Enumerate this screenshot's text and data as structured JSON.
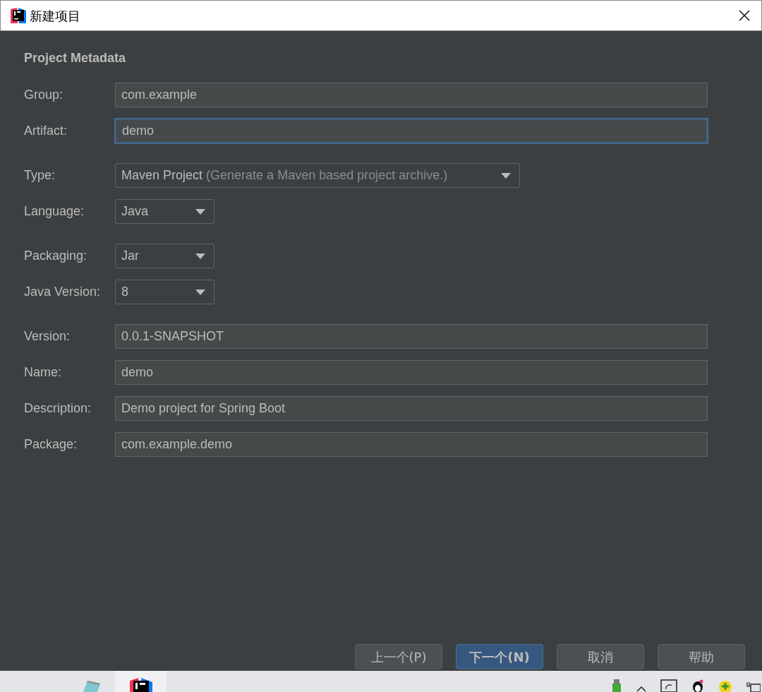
{
  "window": {
    "title": "新建项目"
  },
  "heading": "Project Metadata",
  "sections": [
    [
      {
        "label": "Group:",
        "kind": "text",
        "value": "com.example",
        "focused": false
      },
      {
        "label": "Artifact:",
        "kind": "text",
        "value": "demo",
        "focused": true
      }
    ],
    [
      {
        "label": "Type:",
        "kind": "select",
        "value": "Maven Project",
        "hint": "(Generate a Maven based project archive.)"
      },
      {
        "label": "Language:",
        "kind": "select",
        "value": "Java"
      }
    ],
    [
      {
        "label": "Packaging:",
        "kind": "select",
        "value": "Jar"
      },
      {
        "label": "Java Version:",
        "kind": "select",
        "value": "8"
      }
    ],
    [
      {
        "label": "Version:",
        "kind": "text",
        "value": "0.0.1-SNAPSHOT",
        "focused": false
      },
      {
        "label": "Name:",
        "kind": "text",
        "value": "demo",
        "focused": false
      },
      {
        "label": "Description:",
        "kind": "text",
        "value": "Demo project for Spring Boot",
        "focused": false
      },
      {
        "label": "Package:",
        "kind": "text",
        "value": "com.example.demo",
        "focused": false
      }
    ]
  ],
  "buttons": [
    {
      "label": "上一个(P)",
      "primary": false
    },
    {
      "label": "下一个(N)",
      "primary": true
    },
    {
      "label": "取消",
      "primary": false
    },
    {
      "label": "帮助",
      "primary": false
    }
  ],
  "taskbar": {
    "apps": [
      {
        "kind": "notepad",
        "selected": false
      },
      {
        "kind": "intellij",
        "selected": true
      }
    ]
  }
}
